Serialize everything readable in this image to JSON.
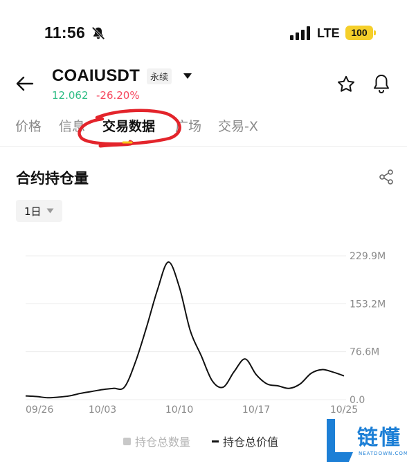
{
  "status_bar": {
    "time": "11:56",
    "network": "LTE",
    "battery": "100"
  },
  "header": {
    "symbol": "COAIUSDT",
    "badge": "永续",
    "price": "12.062",
    "change": "-26.20%",
    "price_color": "#2ebd85",
    "change_color": "#f6465d"
  },
  "tabs": [
    {
      "label": "价格",
      "active": false
    },
    {
      "label": "信息",
      "active": false
    },
    {
      "label": "交易数据",
      "active": true
    },
    {
      "label": "广场",
      "active": false
    },
    {
      "label": "交易-X",
      "active": false
    }
  ],
  "section": {
    "title": "合约持仓量",
    "period": "1日"
  },
  "legend": {
    "quantity_label": "持仓总数量",
    "value_label": "持仓总价值"
  },
  "watermark": {
    "text": "链懂",
    "sub": "NEATDOWN.COM"
  },
  "chart_data": {
    "type": "line",
    "x": [
      "09/26",
      "09/27",
      "09/28",
      "09/29",
      "09/30",
      "10/01",
      "10/02",
      "10/03",
      "10/04",
      "10/05",
      "10/06",
      "10/07",
      "10/08",
      "10/09",
      "10/10",
      "10/11",
      "10/12",
      "10/13",
      "10/14",
      "10/15",
      "10/16",
      "10/17",
      "10/18",
      "10/19",
      "10/20",
      "10/21",
      "10/22",
      "10/23",
      "10/24",
      "10/25"
    ],
    "xticks": [
      "09/26",
      "10/03",
      "10/10",
      "10/17",
      "10/25"
    ],
    "yticks": [
      "229.9M",
      "153.2M",
      "76.6M",
      "0.0"
    ],
    "ylim": [
      0,
      229.9
    ],
    "series": [
      {
        "name": "持仓总价值",
        "values": [
          6,
          5,
          3,
          4,
          6,
          10,
          13,
          16,
          18,
          20,
          60,
          115,
          175,
          220,
          180,
          110,
          70,
          30,
          20,
          45,
          65,
          40,
          25,
          22,
          18,
          25,
          42,
          48,
          44,
          38
        ]
      }
    ],
    "grid": true
  }
}
